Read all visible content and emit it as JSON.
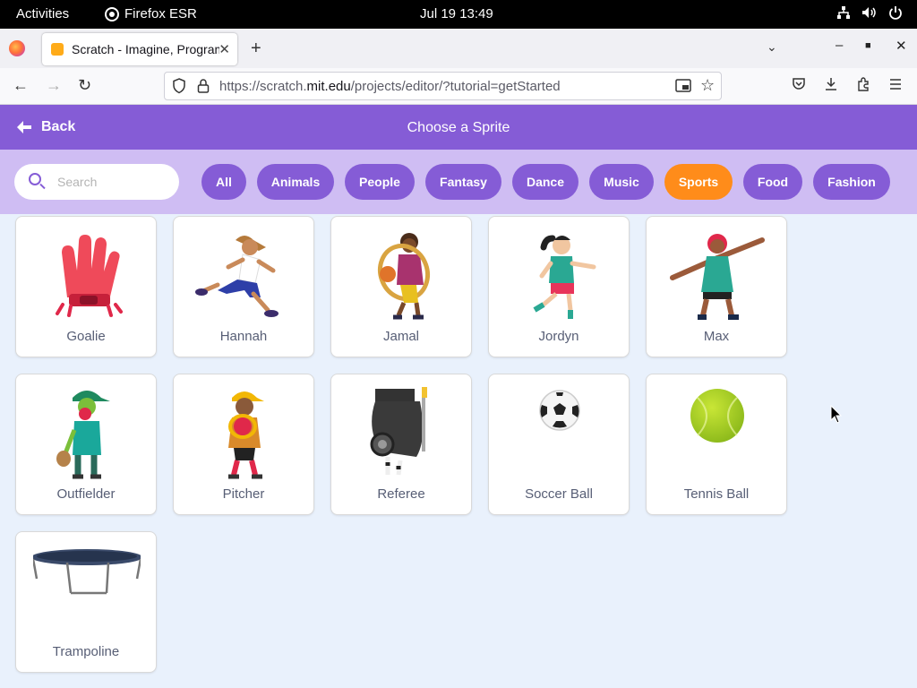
{
  "system_bar": {
    "activities": "Activities",
    "app_name": "Firefox ESR",
    "clock": "Jul 19  13:49"
  },
  "browser": {
    "tab_title": "Scratch - Imagine, Program, Create",
    "url_host_prefix": "https://scratch.",
    "url_host_domain": "mit.edu",
    "url_path": "/projects/editor/?tutorial=getStarted"
  },
  "scratch": {
    "back_label": "Back",
    "title": "Choose a Sprite",
    "search_placeholder": "Search",
    "categories": [
      "All",
      "Animals",
      "People",
      "Fantasy",
      "Dance",
      "Music",
      "Sports",
      "Food",
      "Fashion"
    ],
    "active_category": "Sports",
    "sprites": [
      "Goalie",
      "Hannah",
      "Jamal",
      "Jordyn",
      "Max",
      "Outfielder",
      "Pitcher",
      "Referee",
      "Soccer Ball",
      "Tennis Ball",
      "Trampoline"
    ]
  },
  "colors": {
    "scratch_purple": "#855cd6",
    "filter_bar": "#cfbdf3",
    "active_chip": "#ff8c1a",
    "page_background": "#e9f1fc"
  }
}
